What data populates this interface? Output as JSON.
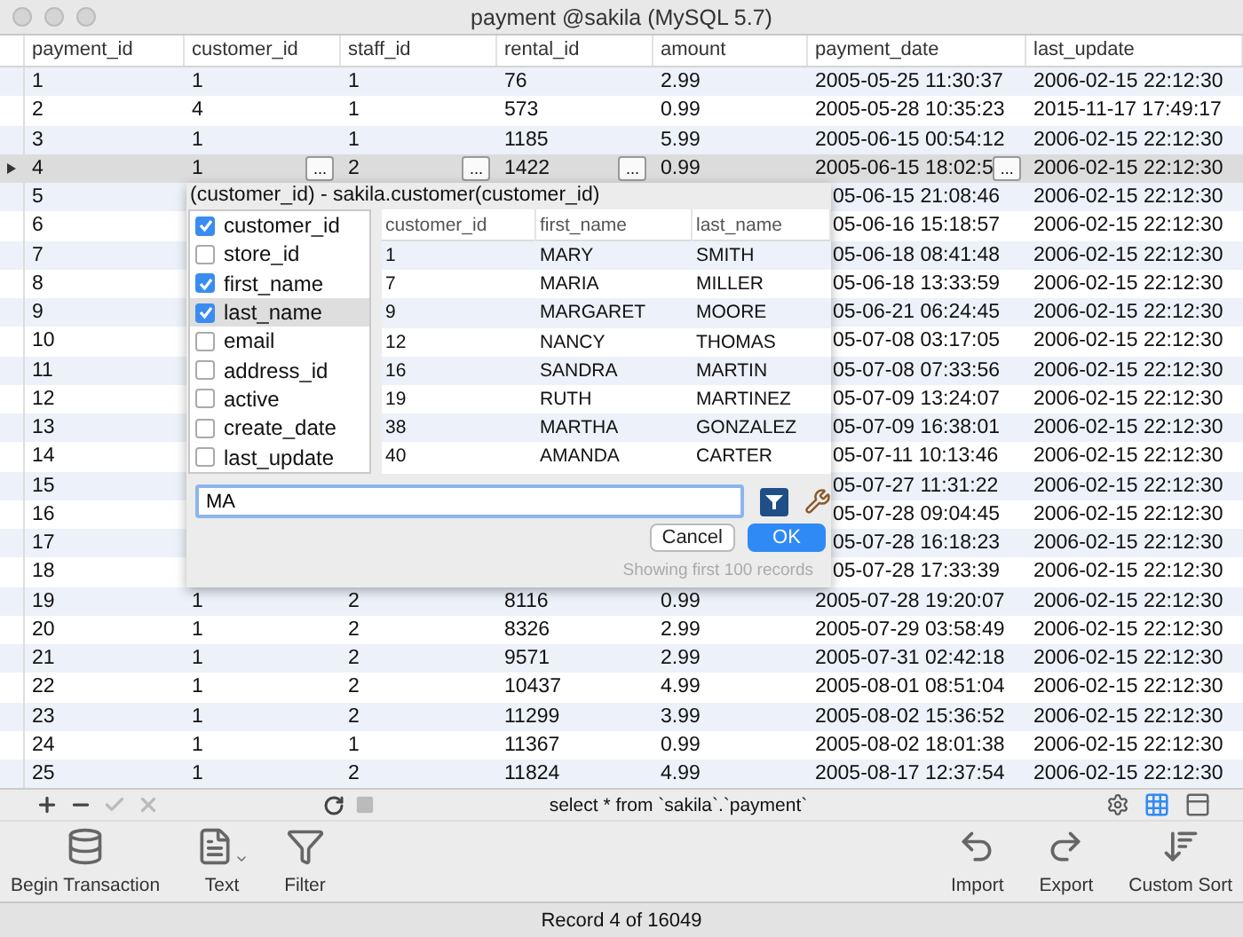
{
  "window": {
    "title": "payment @sakila (MySQL 5.7)"
  },
  "table": {
    "columns": [
      "payment_id",
      "customer_id",
      "staff_id",
      "rental_id",
      "amount",
      "payment_date",
      "last_update"
    ],
    "rows": [
      {
        "kind": "full",
        "selected": false,
        "cells": [
          "1",
          "1",
          "1",
          "76",
          "2.99",
          "2005-05-25 11:30:37",
          "2006-02-15 22:12:30"
        ]
      },
      {
        "kind": "full",
        "selected": false,
        "cells": [
          "2",
          "4",
          "1",
          "573",
          "0.99",
          "2005-05-28 10:35:23",
          "2015-11-17 17:49:17"
        ]
      },
      {
        "kind": "full",
        "selected": false,
        "cells": [
          "3",
          "1",
          "1",
          "1185",
          "5.99",
          "2005-06-15 00:54:12",
          "2006-02-15 22:12:30"
        ]
      },
      {
        "kind": "full",
        "selected": true,
        "cells": [
          "4",
          {
            "text": "1",
            "button": "..."
          },
          {
            "text": "2",
            "button": "..."
          },
          {
            "text": "1422",
            "button": "..."
          },
          "0.99",
          {
            "text": "2005-06-15 18:02:5",
            "button": "..."
          },
          "2006-02-15 22:12:30"
        ]
      },
      {
        "kind": "covered",
        "selected": false,
        "cells": [
          "5",
          "05-06-15 21:08:46",
          "2006-02-15 22:12:30"
        ]
      },
      {
        "kind": "covered",
        "selected": false,
        "cells": [
          "6",
          "05-06-16 15:18:57",
          "2006-02-15 22:12:30"
        ]
      },
      {
        "kind": "covered",
        "selected": false,
        "cells": [
          "7",
          "05-06-18 08:41:48",
          "2006-02-15 22:12:30"
        ]
      },
      {
        "kind": "covered",
        "selected": false,
        "cells": [
          "8",
          "05-06-18 13:33:59",
          "2006-02-15 22:12:30"
        ]
      },
      {
        "kind": "covered",
        "selected": false,
        "cells": [
          "9",
          "05-06-21 06:24:45",
          "2006-02-15 22:12:30"
        ]
      },
      {
        "kind": "covered",
        "selected": false,
        "cells": [
          "10",
          "05-07-08 03:17:05",
          "2006-02-15 22:12:30"
        ]
      },
      {
        "kind": "covered",
        "selected": false,
        "cells": [
          "11",
          "05-07-08 07:33:56",
          "2006-02-15 22:12:30"
        ]
      },
      {
        "kind": "covered",
        "selected": false,
        "cells": [
          "12",
          "05-07-09 13:24:07",
          "2006-02-15 22:12:30"
        ]
      },
      {
        "kind": "covered",
        "selected": false,
        "cells": [
          "13",
          "05-07-09 16:38:01",
          "2006-02-15 22:12:30"
        ]
      },
      {
        "kind": "covered",
        "selected": false,
        "cells": [
          "14",
          "05-07-11 10:13:46",
          "2006-02-15 22:12:30"
        ]
      },
      {
        "kind": "covered",
        "selected": false,
        "cells": [
          "15",
          "05-07-27 11:31:22",
          "2006-02-15 22:12:30"
        ]
      },
      {
        "kind": "covered",
        "selected": false,
        "cells": [
          "16",
          "05-07-28 09:04:45",
          "2006-02-15 22:12:30"
        ]
      },
      {
        "kind": "covered",
        "selected": false,
        "cells": [
          "17",
          "05-07-28 16:18:23",
          "2006-02-15 22:12:30"
        ]
      },
      {
        "kind": "covered",
        "selected": false,
        "cells": [
          "18",
          "05-07-28 17:33:39",
          "2006-02-15 22:12:30"
        ]
      },
      {
        "kind": "full",
        "selected": false,
        "cells": [
          "19",
          "1",
          "2",
          "8116",
          "0.99",
          "2005-07-28 19:20:07",
          "2006-02-15 22:12:30"
        ]
      },
      {
        "kind": "full",
        "selected": false,
        "cells": [
          "20",
          "1",
          "2",
          "8326",
          "2.99",
          "2005-07-29 03:58:49",
          "2006-02-15 22:12:30"
        ]
      },
      {
        "kind": "full",
        "selected": false,
        "cells": [
          "21",
          "1",
          "2",
          "9571",
          "2.99",
          "2005-07-31 02:42:18",
          "2006-02-15 22:12:30"
        ]
      },
      {
        "kind": "full",
        "selected": false,
        "cells": [
          "22",
          "1",
          "2",
          "10437",
          "4.99",
          "2005-08-01 08:51:04",
          "2006-02-15 22:12:30"
        ]
      },
      {
        "kind": "full",
        "selected": false,
        "cells": [
          "23",
          "1",
          "2",
          "11299",
          "3.99",
          "2005-08-02 15:36:52",
          "2006-02-15 22:12:30"
        ]
      },
      {
        "kind": "full",
        "selected": false,
        "cells": [
          "24",
          "1",
          "1",
          "11367",
          "0.99",
          "2005-08-02 18:01:38",
          "2006-02-15 22:12:30"
        ]
      },
      {
        "kind": "full",
        "selected": false,
        "cells": [
          "25",
          "1",
          "2",
          "11824",
          "4.99",
          "2005-08-17 12:37:54",
          "2006-02-15 22:12:30"
        ]
      }
    ]
  },
  "lookup": {
    "title": "(customer_id) - sakila.customer(customer_id)",
    "fields": [
      {
        "label": "customer_id",
        "checked": true,
        "selected": false
      },
      {
        "label": "store_id",
        "checked": false,
        "selected": false
      },
      {
        "label": "first_name",
        "checked": true,
        "selected": false
      },
      {
        "label": "last_name",
        "checked": true,
        "selected": true
      },
      {
        "label": "email",
        "checked": false,
        "selected": false
      },
      {
        "label": "address_id",
        "checked": false,
        "selected": false
      },
      {
        "label": "active",
        "checked": false,
        "selected": false
      },
      {
        "label": "create_date",
        "checked": false,
        "selected": false
      },
      {
        "label": "last_update",
        "checked": false,
        "selected": false
      }
    ],
    "columns": [
      "customer_id",
      "first_name",
      "last_name"
    ],
    "rows": [
      [
        "1",
        "MARY",
        "SMITH"
      ],
      [
        "7",
        "MARIA",
        "MILLER"
      ],
      [
        "9",
        "MARGARET",
        "MOORE"
      ],
      [
        "12",
        "NANCY",
        "THOMAS"
      ],
      [
        "16",
        "SANDRA",
        "MARTIN"
      ],
      [
        "19",
        "RUTH",
        "MARTINEZ"
      ],
      [
        "38",
        "MARTHA",
        "GONZALEZ"
      ],
      [
        "40",
        "AMANDA",
        "CARTER"
      ]
    ],
    "search": {
      "value": "MA"
    },
    "buttons": [
      {
        "label": "Cancel",
        "kind": "secondary"
      },
      {
        "label": "OK",
        "kind": "primary"
      }
    ],
    "note": "Showing first 100 records"
  },
  "edit_bar": {
    "query": "select * from `sakila`.`payment`",
    "views": [
      {
        "kind": "grid",
        "selected": true
      },
      {
        "kind": "form",
        "selected": false
      }
    ]
  },
  "left_tools": [
    {
      "kind": "transaction",
      "label": "Begin Transaction"
    },
    {
      "kind": "text",
      "label": "Text"
    },
    {
      "kind": "filter",
      "label": "Filter"
    }
  ],
  "right_tools": [
    {
      "kind": "import",
      "label": "Import"
    },
    {
      "kind": "export",
      "label": "Export"
    },
    {
      "kind": "sort",
      "label": "Custom Sort"
    }
  ],
  "status_bar": "Record 4 of 16049"
}
